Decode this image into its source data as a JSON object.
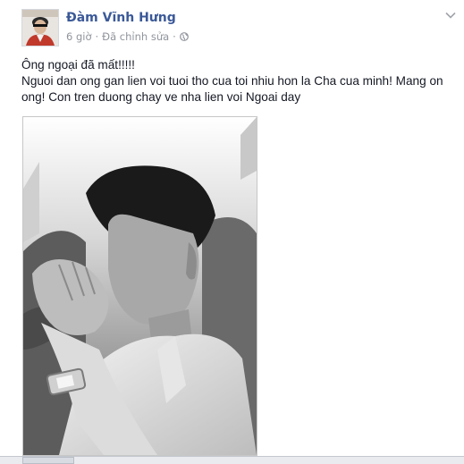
{
  "post": {
    "author": "Đàm Vĩnh Hưng",
    "time": "6 giờ",
    "separator": "·",
    "edited": "Đã chỉnh sửa",
    "text_line1": "Ông ngoại đã mất!!!!!",
    "text_line2": "Nguoi dan ong gan lien voi tuoi tho cua toi nhiu hon la Cha cua minh! Mang on ong! Con tren duong chay ve nha lien voi Ngoai day"
  },
  "icons": {
    "globe": "globe-icon",
    "chevron": "chevron-down-icon"
  },
  "colors": {
    "author_link": "#3b5998",
    "meta_text": "#90949c",
    "body_text": "#141823"
  }
}
